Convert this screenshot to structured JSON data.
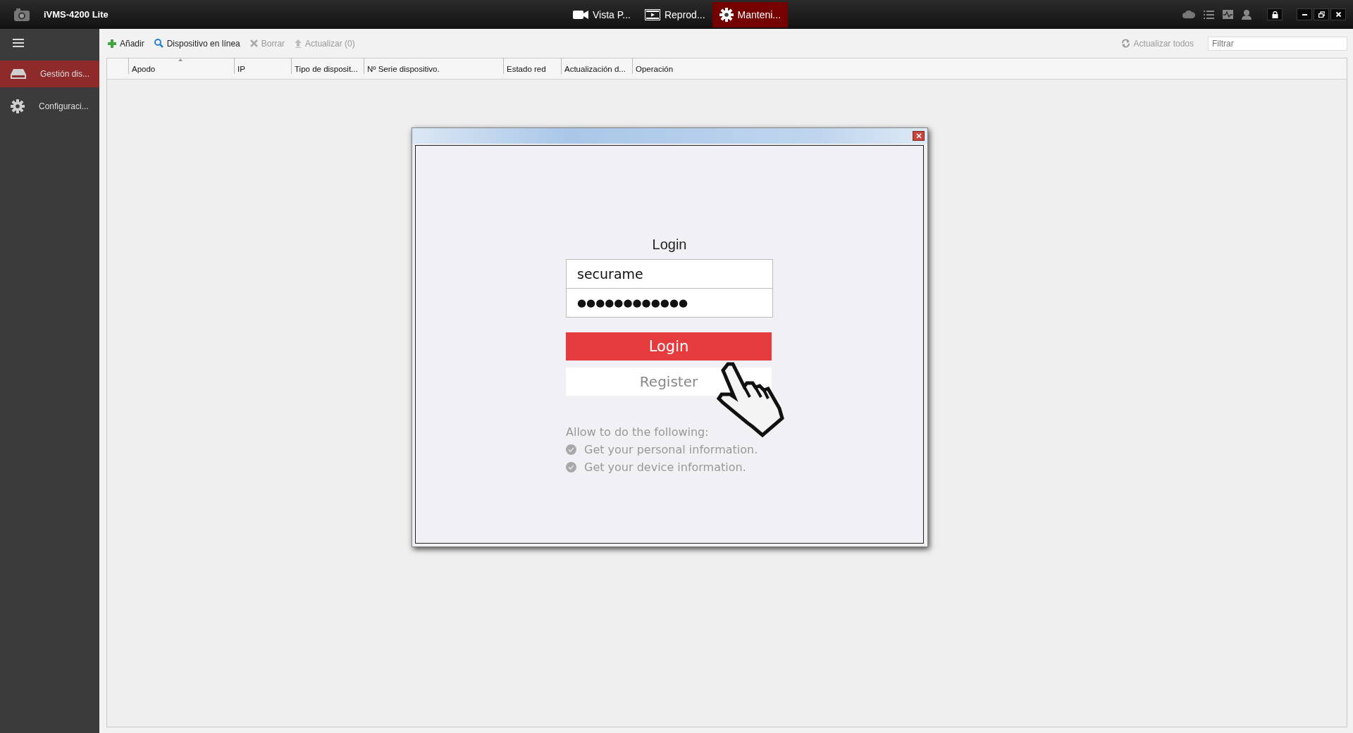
{
  "window": {
    "title": "iVMS-4200 Lite"
  },
  "top_tabs": [
    {
      "label": "Vista P...",
      "selected": false
    },
    {
      "label": "Reprod...",
      "selected": false
    },
    {
      "label": "Manteni...",
      "selected": true
    }
  ],
  "sidebar": {
    "items": [
      {
        "label": "Gestión dis...",
        "selected": true
      },
      {
        "label": "Configuraci...",
        "selected": false
      }
    ]
  },
  "toolbar": {
    "buttons": [
      {
        "label": "Añadir",
        "disabled": false
      },
      {
        "label": "Dispositivo en línea",
        "disabled": false
      },
      {
        "label": "Borrar",
        "disabled": true
      },
      {
        "label": "Actualizar (0)",
        "disabled": true
      }
    ],
    "refresh_all": "Actualizar todos",
    "filter": {
      "placeholder": "Filtrar"
    }
  },
  "table": {
    "columns": [
      {
        "label": "Apodo",
        "sorted": true
      },
      {
        "label": "IP",
        "sorted": false
      },
      {
        "label": "Tipo de disposit...",
        "sorted": false
      },
      {
        "label": "Nº Serie dispositivo.",
        "sorted": false
      },
      {
        "label": "Estado red",
        "sorted": false
      },
      {
        "label": "Actualización d...",
        "sorted": false
      },
      {
        "label": "Operación",
        "sorted": false
      }
    ]
  },
  "dialog": {
    "heading": "Login",
    "username": "securame",
    "password": "●●●●●●●●●●●●",
    "login_button": "Login",
    "register_button": "Register",
    "permissions_intro": "Allow to do the following:",
    "permissions": [
      {
        "label": "Get your personal information.",
        "checked": true
      },
      {
        "label": "Get your device information.",
        "checked": true
      }
    ]
  }
}
